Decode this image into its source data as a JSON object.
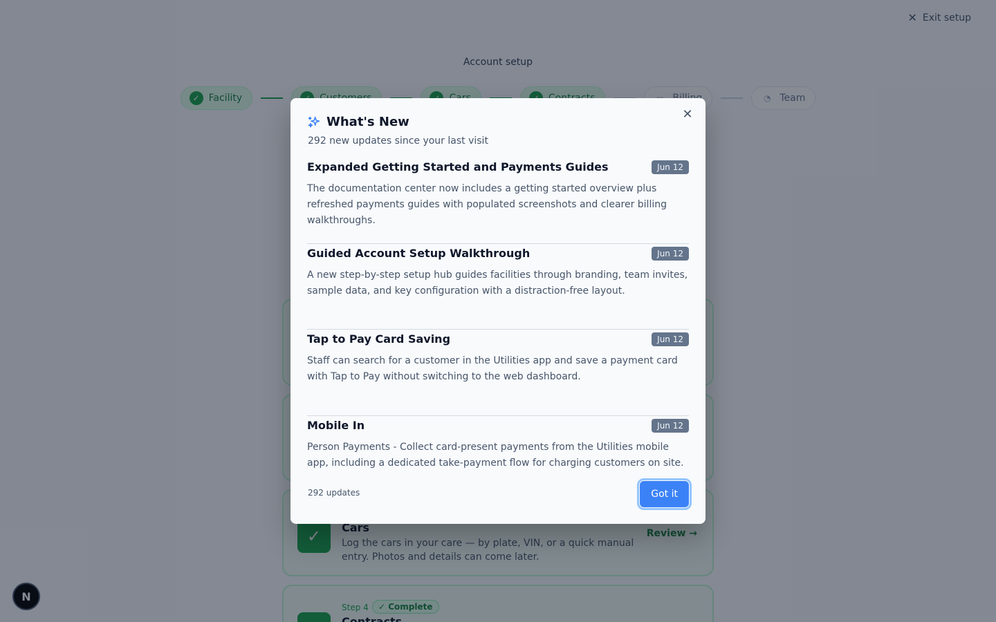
{
  "header": {
    "exit_label": "Exit setup",
    "page_title": "Account setup"
  },
  "stepper": {
    "steps": [
      {
        "label": "Facility",
        "status": "complete"
      },
      {
        "label": "Customers",
        "status": "complete"
      },
      {
        "label": "Cars",
        "status": "complete"
      },
      {
        "label": "Contracts",
        "status": "complete"
      },
      {
        "label": "Billing",
        "status": "pending"
      },
      {
        "label": "Team",
        "status": "pending"
      }
    ]
  },
  "cards": {
    "cars": {
      "title": "Cars",
      "description": "Log the cars in your care — by plate, VIN, or a quick manual entry. Photos and details can come later.",
      "action": "Review"
    },
    "contracts": {
      "step_label": "Step 4",
      "badge": "Complete",
      "title": "Contracts"
    }
  },
  "dev_badge": "N",
  "modal": {
    "title": "What's New",
    "subtitle": "292 new updates since your last visit",
    "entries": [
      {
        "title": "Expanded Getting Started and Payments Guides",
        "date": "Jun 12",
        "description": "The documentation center now includes a getting started overview plus refreshed payments guides with populated screenshots and clearer billing walkthroughs."
      },
      {
        "title": "Guided Account Setup Walkthrough",
        "date": "Jun 12",
        "description": "A new step-by-step setup hub guides facilities through branding, team invites, sample data, and key configuration with a distraction-free layout."
      },
      {
        "title": "Tap to Pay Card Saving",
        "date": "Jun 12",
        "description": "Staff can search for a customer in the Utilities app and save a payment card with Tap to Pay without switching to the web dashboard."
      },
      {
        "title": "Mobile In",
        "date": "Jun 12",
        "description": "Person Payments - Collect card-present payments from the Utilities mobile app, including a dedicated take-payment flow for charging customers on site."
      }
    ],
    "footer_count": "292 updates",
    "confirm_label": "Got it"
  },
  "colors": {
    "accent": "#3b82f6",
    "success": "#16a34a",
    "badge_bg": "#64748b"
  }
}
